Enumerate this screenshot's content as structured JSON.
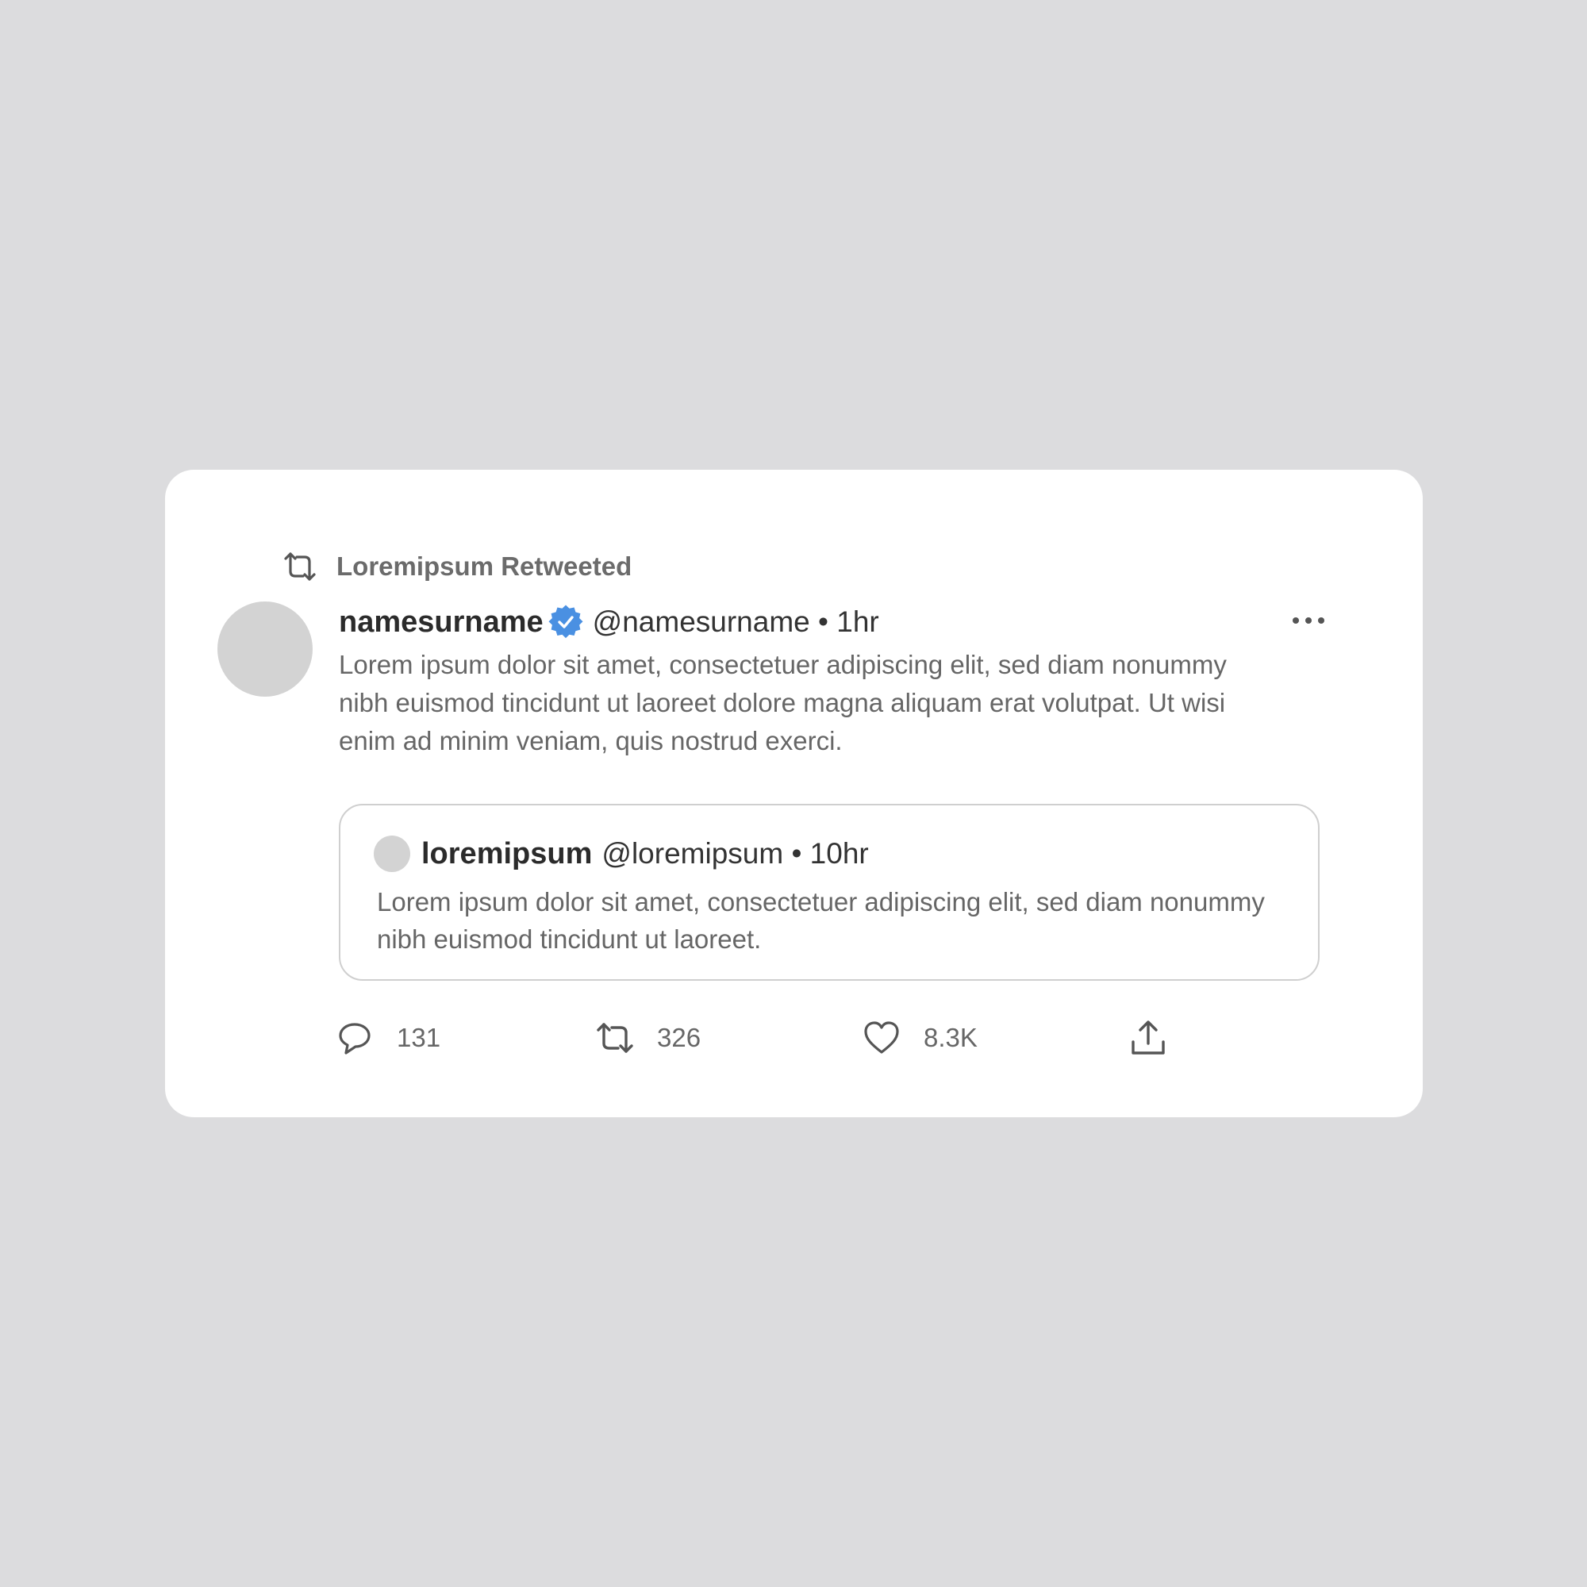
{
  "retweet_banner": {
    "icon": "retweet-icon",
    "text": "Loremipsum Retweeted"
  },
  "tweet": {
    "display_name": "namesurname",
    "verified_icon": "verified-badge-icon",
    "verified_color": "#4a90e2",
    "handle_meta": "@namesurname • 1hr",
    "more_icon": "more-horizontal-icon",
    "text": "Lorem ipsum dolor sit amet, consectetuer adipiscing elit, sed diam nonummy nibh euismod tincidunt ut laoreet dolore magna aliquam erat volutpat. Ut wisi enim ad minim veniam, quis nostrud exerci."
  },
  "quoted_tweet": {
    "display_name": "loremipsum",
    "handle_meta": "@loremipsum • 10hr",
    "text": "Lorem ipsum dolor sit amet, consectetuer adipiscing elit, sed diam nonummy nibh euismod tincidunt ut laoreet."
  },
  "actions": {
    "reply": {
      "icon": "reply-icon",
      "count": "131"
    },
    "retweet": {
      "icon": "retweet-icon",
      "count": "326"
    },
    "like": {
      "icon": "heart-icon",
      "count": "8.3K"
    },
    "share": {
      "icon": "share-icon"
    }
  },
  "colors": {
    "background": "#dcdcde",
    "card": "#ffffff",
    "muted_text": "#666666",
    "strong_text": "#2b2b2b",
    "avatar_placeholder": "#d3d3d3"
  }
}
